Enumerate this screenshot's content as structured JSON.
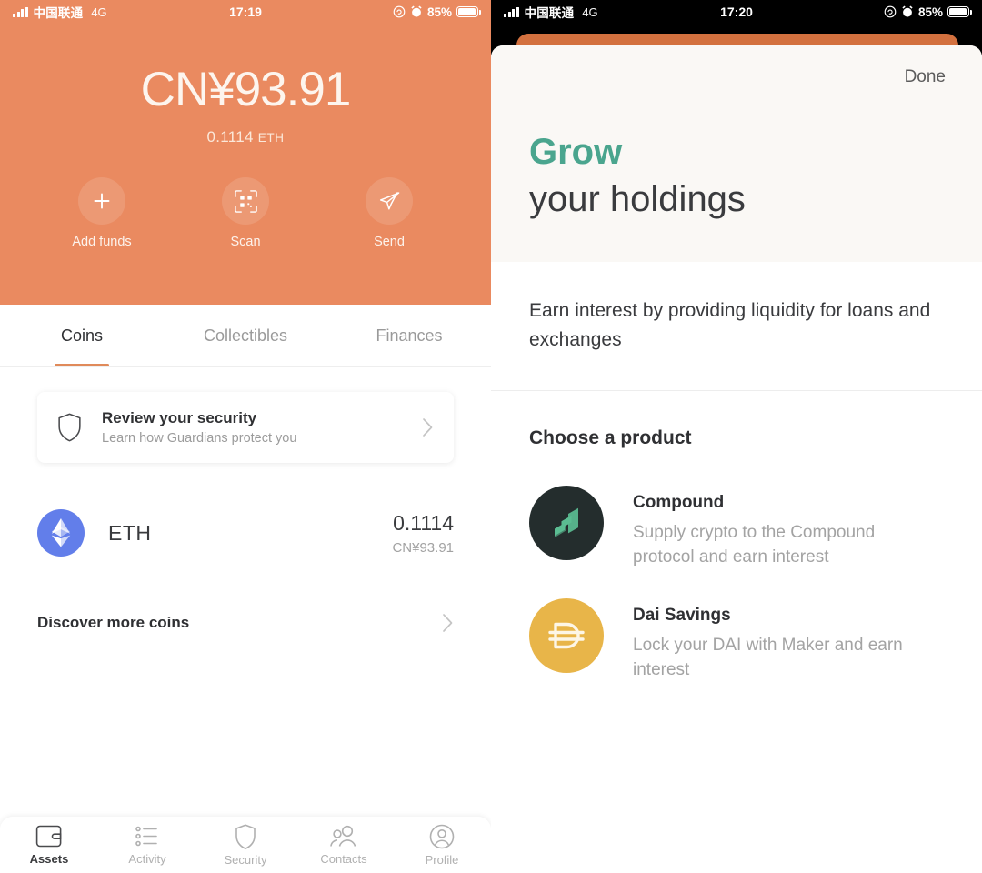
{
  "left": {
    "status_bar": {
      "carrier": "中国联通",
      "network": "4G",
      "time": "17:19",
      "battery_pct": "85%",
      "signal_icon": "signal-bars-icon",
      "rotation_icon": "rotation-lock-icon",
      "alarm_icon": "alarm-clock-icon",
      "battery_icon": "battery-icon"
    },
    "header": {
      "balance": "CN¥93.91",
      "crypto_amount": "0.1114",
      "crypto_unit": "ETH",
      "accent_color": "#ea8a60"
    },
    "actions": [
      {
        "label": "Add funds",
        "icon": "plus-icon"
      },
      {
        "label": "Scan",
        "icon": "qr-scan-icon"
      },
      {
        "label": "Send",
        "icon": "paper-plane-icon"
      }
    ],
    "tabs": [
      {
        "label": "Coins",
        "active": true
      },
      {
        "label": "Collectibles",
        "active": false
      },
      {
        "label": "Finances",
        "active": false
      }
    ],
    "security_card": {
      "title": "Review your security",
      "subtitle": "Learn how Guardians protect you",
      "icon": "shield-icon",
      "chevron": "chevron-right-icon"
    },
    "coins": [
      {
        "symbol": "ETH",
        "amount": "0.1114",
        "fiat": "CN¥93.91",
        "icon": "ethereum-icon",
        "icon_color": "#627eea"
      }
    ],
    "discover": {
      "label": "Discover more coins",
      "chevron": "chevron-right-icon"
    },
    "bottom_nav": [
      {
        "label": "Assets",
        "icon": "wallet-icon",
        "active": true
      },
      {
        "label": "Activity",
        "icon": "list-icon",
        "active": false
      },
      {
        "label": "Security",
        "icon": "shield-icon",
        "active": false
      },
      {
        "label": "Contacts",
        "icon": "contacts-icon",
        "active": false
      },
      {
        "label": "Profile",
        "icon": "profile-icon",
        "active": false
      }
    ]
  },
  "right": {
    "status_bar": {
      "carrier": "中国联通",
      "network": "4G",
      "time": "17:20",
      "battery_pct": "85%"
    },
    "sheet": {
      "done_label": "Done",
      "hero_line1": "Grow",
      "hero_line1_color": "#4aa58e",
      "hero_line2": "your holdings",
      "description": "Earn interest by providing liquidity for loans and exchanges",
      "section_title": "Choose a product",
      "products": [
        {
          "name": "Compound",
          "description": "Supply crypto to the Compound protocol and earn interest",
          "icon": "compound-logo-icon",
          "icon_bg": "#242d2d",
          "icon_fg": "#5bbd92"
        },
        {
          "name": "Dai Savings",
          "description": "Lock your DAI with Maker and earn interest",
          "icon": "dai-logo-icon",
          "icon_bg": "#e8b549",
          "icon_fg": "#fdf6e6"
        }
      ]
    }
  }
}
